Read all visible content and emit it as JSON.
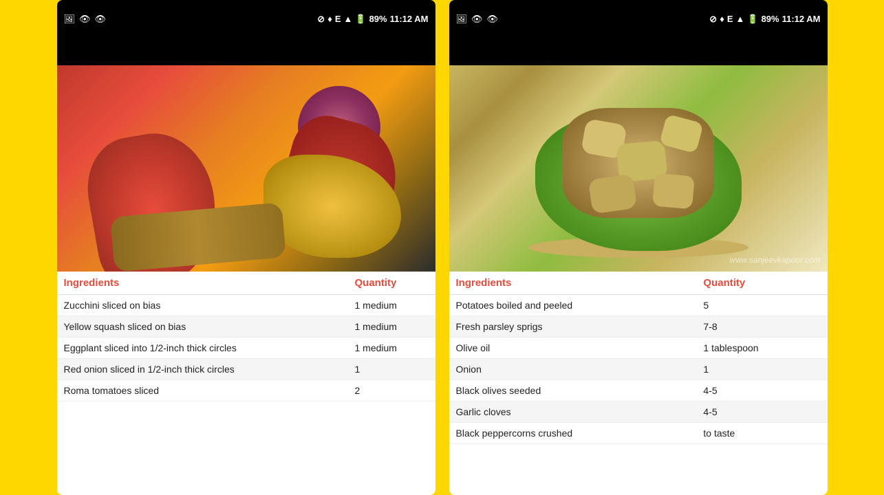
{
  "page": {
    "background": "#FFD700"
  },
  "left_phone": {
    "status_bar": {
      "battery": "89%",
      "time": "11:12 AM",
      "signal": "E"
    },
    "table": {
      "header_ingredients": "Ingredients",
      "header_quantity": "Quantity",
      "rows": [
        {
          "ingredient": "Zucchini sliced on bias",
          "quantity": "1 medium"
        },
        {
          "ingredient": "Yellow squash sliced on bias",
          "quantity": "1 medium"
        },
        {
          "ingredient": "Eggplant sliced into 1/2-inch thick circles",
          "quantity": "1 medium"
        },
        {
          "ingredient": "Red onion sliced in 1/2-inch thick circles",
          "quantity": "1"
        },
        {
          "ingredient": "Roma tomatoes sliced",
          "quantity": "2"
        }
      ]
    }
  },
  "right_phone": {
    "status_bar": {
      "battery": "89%",
      "time": "11:12 AM",
      "signal": "E"
    },
    "watermark": "www.sanjeevkapoor.com",
    "table": {
      "header_ingredients": "Ingredients",
      "header_quantity": "Quantity",
      "rows": [
        {
          "ingredient": "Potatoes boiled and peeled",
          "quantity": "5"
        },
        {
          "ingredient": "Fresh parsley sprigs",
          "quantity": "7-8"
        },
        {
          "ingredient": "Olive oil",
          "quantity": "1 tablespoon"
        },
        {
          "ingredient": "Onion",
          "quantity": "1"
        },
        {
          "ingredient": "Black olives seeded",
          "quantity": "4-5"
        },
        {
          "ingredient": "Garlic cloves",
          "quantity": "4-5"
        },
        {
          "ingredient": "Black peppercorns crushed",
          "quantity": "to taste"
        }
      ]
    }
  }
}
